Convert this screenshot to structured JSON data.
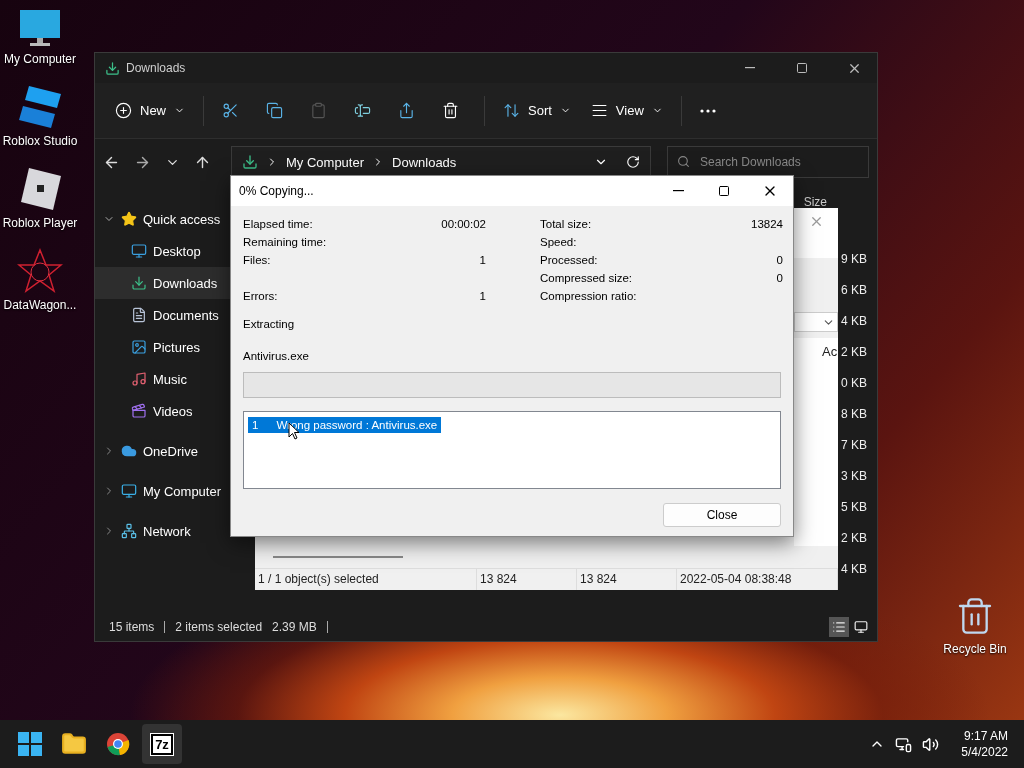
{
  "desktop_icons": [
    {
      "label": "My Computer",
      "kind": "monitor"
    },
    {
      "label": "Roblox Studio",
      "kind": "studio"
    },
    {
      "label": "Roblox Player",
      "kind": "player"
    },
    {
      "label": "DataWagon...",
      "kind": "star"
    }
  ],
  "recycle_bin": {
    "label": "Recycle Bin"
  },
  "explorer": {
    "title": "Downloads",
    "toolbar": [
      {
        "kind": "new",
        "label": "New",
        "disabled": false
      },
      {
        "kind": "cut",
        "disabled": false
      },
      {
        "kind": "copy",
        "disabled": false
      },
      {
        "kind": "paste",
        "disabled": true
      },
      {
        "kind": "rename",
        "disabled": false
      },
      {
        "kind": "share",
        "disabled": false
      },
      {
        "kind": "delete",
        "disabled": false
      },
      {
        "kind": "sort",
        "label": "Sort",
        "disabled": false
      },
      {
        "kind": "view",
        "label": "View",
        "disabled": false
      },
      {
        "kind": "more",
        "disabled": false
      }
    ],
    "breadcrumb": [
      "My Computer",
      "Downloads"
    ],
    "search": {
      "placeholder": "Search Downloads"
    },
    "sidebar": [
      {
        "label": "Quick access",
        "kind": "star",
        "expanded": true,
        "selected": false,
        "children": [
          {
            "label": "Desktop",
            "kind": "desktop",
            "selected": false
          },
          {
            "label": "Downloads",
            "kind": "download",
            "selected": true
          },
          {
            "label": "Documents",
            "kind": "document",
            "selected": false
          },
          {
            "label": "Pictures",
            "kind": "picture",
            "selected": false
          },
          {
            "label": "Music",
            "kind": "music",
            "selected": false
          },
          {
            "label": "Videos",
            "kind": "video",
            "selected": false
          }
        ]
      },
      {
        "label": "OneDrive",
        "kind": "cloud",
        "expanded": false,
        "selected": false
      },
      {
        "label": "My Computer",
        "kind": "monitor",
        "expanded": false,
        "selected": false
      },
      {
        "label": "Network",
        "kind": "network",
        "expanded": false,
        "selected": false
      }
    ],
    "column_header": "Size",
    "sizes": [
      "9 KB",
      "6 KB",
      "4 KB",
      "2 KB",
      "0 KB",
      "8 KB",
      "7 KB",
      "3 KB",
      "5 KB",
      "2 KB",
      "4 KB"
    ],
    "status": {
      "items": "15 items",
      "selected": "2 items selected",
      "size": "2.39 MB"
    },
    "views": [
      {
        "kind": "details",
        "selected": true
      },
      {
        "kind": "tiles",
        "selected": false
      }
    ]
  },
  "archive_window": {
    "column_header": "Ac",
    "status": [
      "1 / 1 object(s) selected",
      "13 824",
      "13 824",
      "2022-05-04 08:38:48"
    ]
  },
  "dialog": {
    "title": "0% Copying...",
    "stats": [
      {
        "left_label": "Elapsed time:",
        "left_value": "00:00:02",
        "right_label": "Total size:",
        "right_value": "13824"
      },
      {
        "left_label": "Remaining time:",
        "right_label": "Speed:"
      },
      {
        "left_label": "Files:",
        "left_value": "1",
        "right_label": "Processed:",
        "right_value": "0"
      },
      {
        "right_label": "Compressed size:",
        "right_value": "0"
      },
      {
        "left_label": "Errors:",
        "left_value": "1",
        "right_label": "Compression ratio:"
      }
    ],
    "status_text": "Extracting",
    "current_file": "Antivirus.exe",
    "progress": {
      "level": 0
    },
    "messages": [
      {
        "index": "1",
        "text": "Wrong password : Antivirus.exe",
        "selected": true
      }
    ],
    "button": "Close"
  },
  "taskbar": {
    "apps": [
      {
        "kind": "start",
        "selected": false
      },
      {
        "kind": "explorer",
        "selected": false
      },
      {
        "kind": "chrome",
        "selected": false
      },
      {
        "kind": "sevenzip",
        "label": "7z",
        "selected": true
      }
    ],
    "time": "9:17 AM",
    "date": "5/4/2022"
  }
}
